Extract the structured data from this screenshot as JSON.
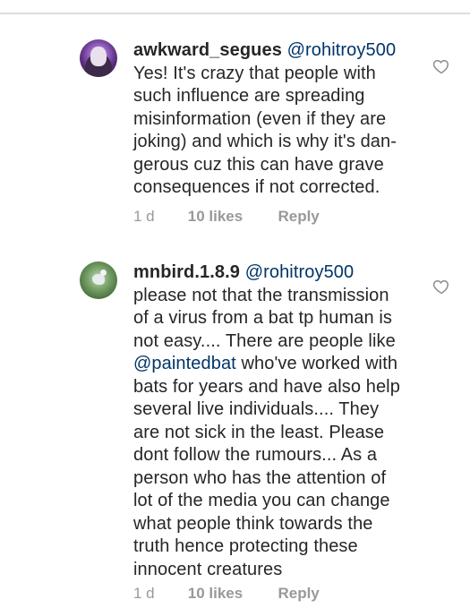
{
  "comments": [
    {
      "username": "awkward_segues",
      "mention": "@rohitroy500",
      "lines": [
        "Yes! It's crazy that people with",
        "such influence are spreading",
        "misinformation (even if they  are",
        "joking) and which is why it's dan-",
        "gerous cuz this can have grave",
        "consequences if not corrected."
      ],
      "time": "1 d",
      "likes": "10 likes",
      "reply_label": "Reply"
    },
    {
      "username": "mnbird.1.8.9",
      "mention": "@rohitroy500",
      "lines": [
        "please not that the transmission",
        "of a virus from a bat tp human is",
        "not easy.... There are people like",
        "who've worked with",
        "bats for years and have also help",
        "several live individuals.... They",
        "are not sick in the least. Please",
        "dont follow the rumours... As a",
        "person who has the attention of",
        "lot of the media you can change",
        "what people think towards the",
        "truth hence protecting these",
        "innocent creatures"
      ],
      "inline_mention": "@paintedbat",
      "time": "1 d",
      "likes": "10 likes",
      "reply_label": "Reply"
    }
  ],
  "icons": {
    "like": "heart-outline-icon"
  },
  "colors": {
    "text": "#262626",
    "mention": "#003569",
    "meta": "#999999",
    "divider": "#dcdcdc"
  }
}
